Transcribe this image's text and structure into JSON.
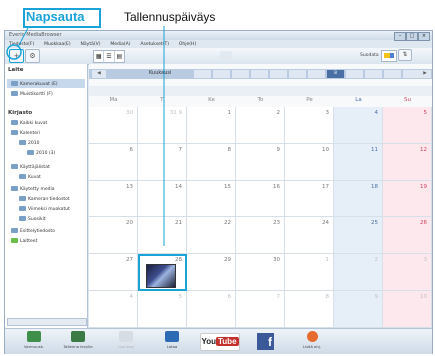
{
  "callout": {
    "text": "Napsauta"
  },
  "annotation": {
    "text": "Tallennuspäiväys"
  },
  "window": {
    "title": "Everio MediaBrowser",
    "menu": [
      "Tiedosto(F)",
      "Muokkaa(E)",
      "Näytä(V)",
      "Media(A)",
      "Asetukset(T)",
      "Ohje(H)"
    ],
    "right_label": "Suodata"
  },
  "sidebar": {
    "section1": "Laite",
    "device_items": [
      "Kamerakuvat (E)",
      "Muistikortti (F)"
    ],
    "section2": "Kirjasto",
    "library_items": [
      "Kaikki kuvat",
      "Kalenteri",
      "2010",
      "2010 (3)",
      "Käyttäjälistat",
      "Kuvat",
      "Käytetty media",
      "Kameran tiedostot",
      "Viimeksi muokatut",
      "Suosikit",
      "Esittelytiedosto",
      "Laitteet"
    ]
  },
  "calendar": {
    "month_label": "Kuukausi",
    "selected_month": "8",
    "weekdays": [
      "Ma",
      "Ti",
      "Ke",
      "To",
      "Pe",
      "La",
      "Su"
    ],
    "weeks": [
      [
        "30",
        "31 9",
        "1",
        "2",
        "3",
        "4",
        "5"
      ],
      [
        "6",
        "7",
        "8",
        "9",
        "10",
        "11",
        "12"
      ],
      [
        "13",
        "14",
        "15",
        "16",
        "17",
        "18",
        "19"
      ],
      [
        "20",
        "21",
        "22",
        "23",
        "24",
        "25",
        "26"
      ],
      [
        "27",
        "28",
        "29",
        "30",
        "1",
        "2",
        "3"
      ],
      [
        "4",
        "5",
        "6",
        "7",
        "8",
        "9",
        "10"
      ]
    ]
  },
  "bottom_buttons": [
    {
      "label": "Varmuusk."
    },
    {
      "label": "Tallenna levylle"
    },
    {
      "label": "Luo levy"
    },
    {
      "label": "Lataa"
    },
    {
      "label": "YouTube"
    },
    {
      "label": "Facebook"
    },
    {
      "label": "Lisää ohj."
    }
  ],
  "colors": {
    "accent": "#1aa3d9",
    "sat": "#e6eef8",
    "sun": "#fde8ee"
  }
}
